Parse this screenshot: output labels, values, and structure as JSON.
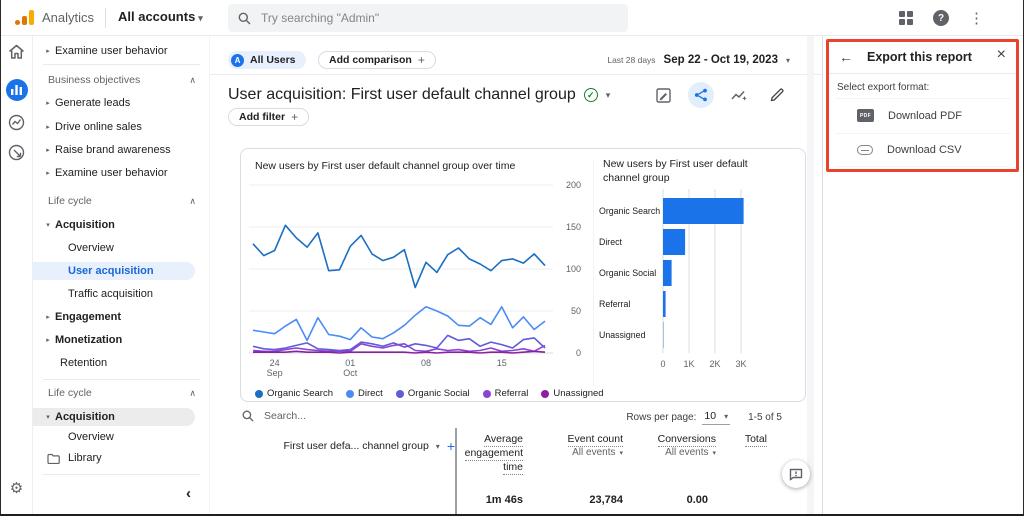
{
  "topbar": {
    "brand": "Analytics",
    "accounts_label": "All accounts",
    "search_placeholder": "Try searching \"Admin\""
  },
  "sidebar": {
    "pre_item": "Examine user behavior",
    "bo_header": "Business objectives",
    "bo_items": [
      "Generate leads",
      "Drive online sales",
      "Raise brand awareness",
      "Examine user behavior"
    ],
    "lc_header": "Life cycle",
    "acquisition_label": "Acquisition",
    "acq_children": [
      "Overview",
      "User acquisition",
      "Traffic acquisition"
    ],
    "other_items": [
      "Engagement",
      "Monetization",
      "Retention"
    ],
    "lc2_header": "Life cycle",
    "acquisition2_label": "Acquisition",
    "overview2_label": "Overview",
    "library_label": "Library"
  },
  "report_header": {
    "all_users_chip": "All Users",
    "add_comparison_chip": "Add comparison",
    "date_preset": "Last 28 days",
    "date_range": "Sep 22 - Oct 19, 2023",
    "title": "User acquisition: First user default channel group",
    "add_filter_chip": "Add filter"
  },
  "export_panel": {
    "title": "Export this report",
    "prompt": "Select export format:",
    "options": [
      {
        "label": "Download PDF",
        "icon": "pdf-file-icon"
      },
      {
        "label": "Download CSV",
        "icon": "csv-file-icon"
      }
    ],
    "highlight_color": "#e8432d"
  },
  "table": {
    "search_placeholder": "Search...",
    "rows_label": "Rows per page:",
    "rows_value": "10",
    "range_text": "1-5 of 5",
    "dimension_header": "First user defa... channel group",
    "col_avg_lines": [
      "Average",
      "engagement",
      "time"
    ],
    "col_event": "Event count",
    "col_event_sub": "All events",
    "col_conv": "Conversions",
    "col_conv_sub": "All events",
    "col_total": "Total",
    "total_avg": "1m 46s",
    "total_event": "23,784",
    "total_conv": "0.00"
  },
  "colors": {
    "accent": "#1a73e8",
    "selected_bg": "#e8f0fe",
    "selected_text": "#1967d2"
  },
  "chart_data": [
    {
      "type": "line",
      "title": "New users by First user default channel group over time",
      "ylim": [
        0,
        200
      ],
      "y_ticks": [
        0,
        50,
        100,
        150,
        200
      ],
      "n_points": 28,
      "x_ticks": [
        "24 Sep",
        "01 Oct",
        "08",
        "15"
      ],
      "x_tick_positions": [
        2,
        9,
        16,
        23
      ],
      "legend_position": "bottom",
      "grid": true,
      "series": [
        {
          "name": "Organic Search",
          "color": "#1b6fc2",
          "values": [
            130,
            116,
            122,
            152,
            137,
            126,
            143,
            98,
            99,
            127,
            140,
            118,
            110,
            114,
            123,
            78,
            108,
            96,
            117,
            125,
            112,
            106,
            98,
            110,
            112,
            107,
            118,
            104
          ]
        },
        {
          "name": "Direct",
          "color": "#4c8bf5",
          "values": [
            27,
            25,
            23,
            32,
            40,
            15,
            42,
            22,
            20,
            16,
            30,
            19,
            17,
            24,
            33,
            45,
            55,
            50,
            44,
            33,
            32,
            42,
            34,
            55,
            30,
            43,
            28,
            38
          ]
        },
        {
          "name": "Organic Social",
          "color": "#5e5cd8",
          "values": [
            8,
            5,
            4,
            6,
            9,
            12,
            5,
            4,
            3,
            4,
            13,
            11,
            8,
            12,
            7,
            11,
            9,
            6,
            21,
            15,
            17,
            8,
            13,
            10,
            6,
            16,
            18,
            6
          ]
        },
        {
          "name": "Referral",
          "color": "#8a45d4",
          "values": [
            3,
            2,
            2,
            4,
            6,
            4,
            3,
            2,
            2,
            2,
            11,
            8,
            6,
            9,
            11,
            3,
            2,
            5,
            3,
            4,
            2,
            3,
            6,
            2,
            3,
            5,
            2,
            9
          ]
        },
        {
          "name": "Unassigned",
          "color": "#8d1fa0",
          "values": [
            1,
            1,
            1,
            1,
            2,
            1,
            1,
            1,
            0,
            1,
            1,
            1,
            1,
            1,
            1,
            0,
            1,
            0,
            1,
            1,
            1,
            0,
            1,
            1,
            0,
            1,
            2,
            1
          ]
        }
      ]
    },
    {
      "type": "bar",
      "orientation": "horizontal",
      "title": "New users by First user default channel group",
      "categories": [
        "Organic Search",
        "Direct",
        "Organic Social",
        "Referral",
        "Unassigned"
      ],
      "values": [
        3100,
        850,
        330,
        100,
        15
      ],
      "xlim": [
        0,
        3500
      ],
      "x_ticks": [
        "0",
        "1K",
        "2K",
        "3K"
      ],
      "x_tick_values": [
        0,
        1000,
        2000,
        3000
      ],
      "bar_color": "#1a73e8",
      "grid": true
    }
  ]
}
